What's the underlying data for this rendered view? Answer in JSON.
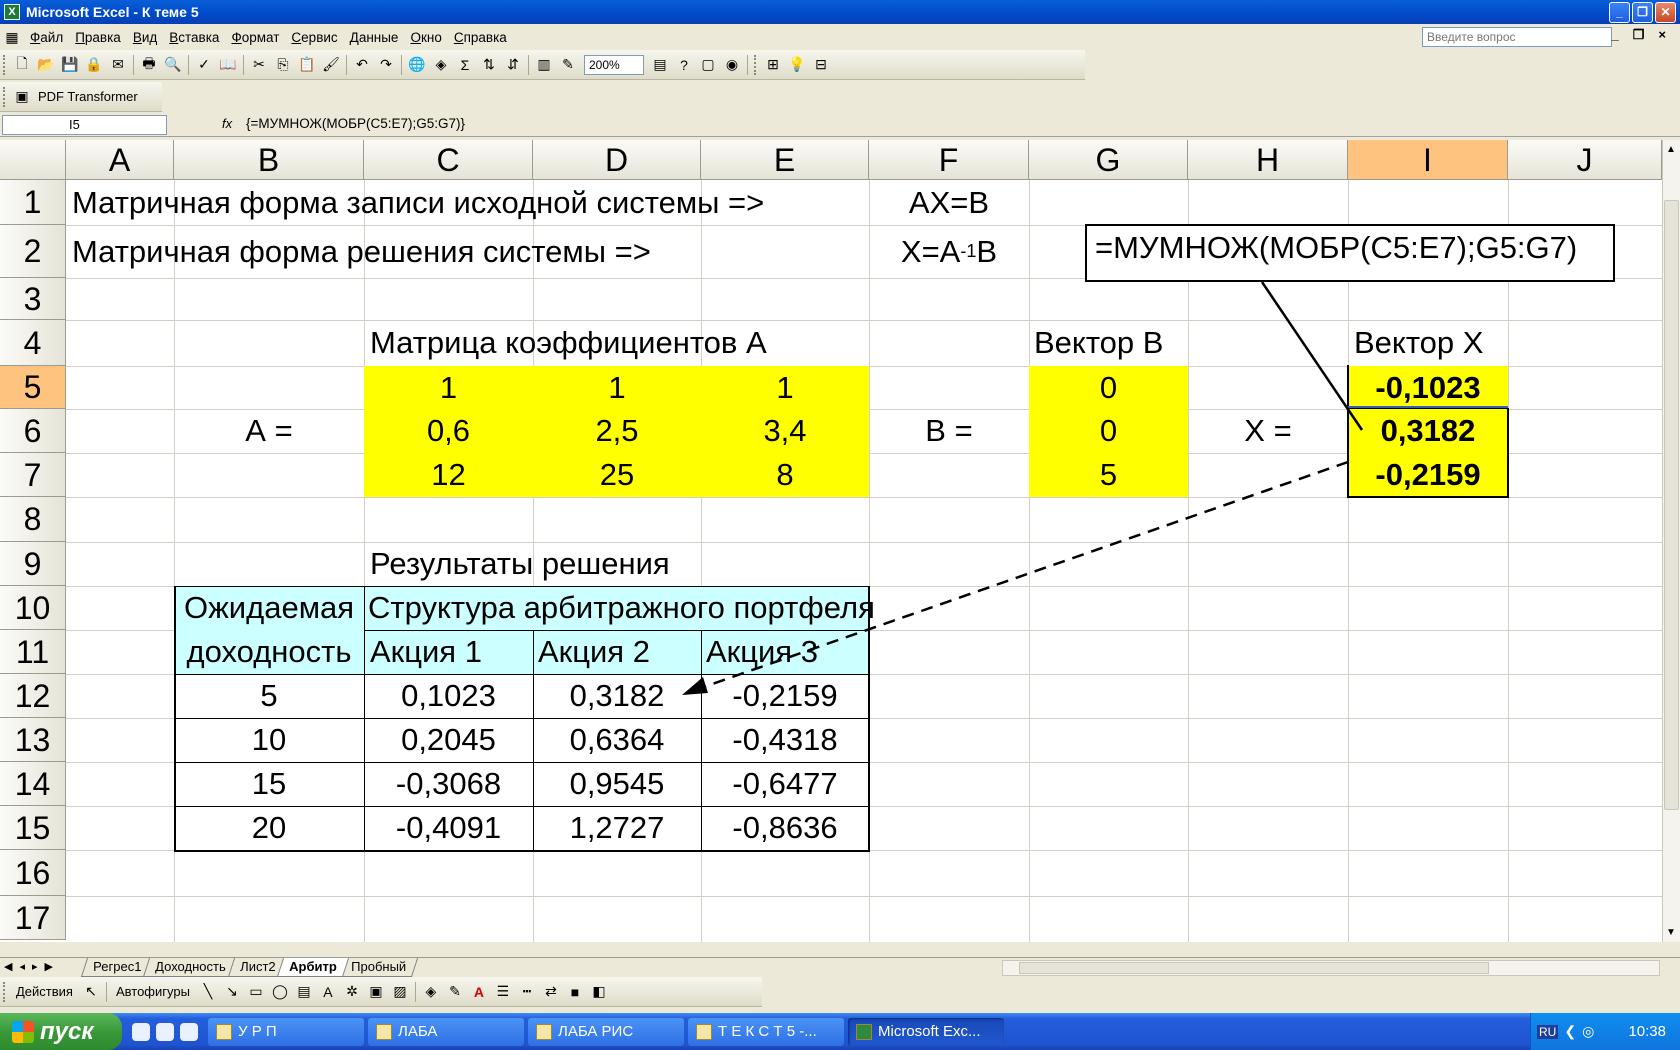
{
  "window": {
    "title": "Microsoft Excel - К теме 5",
    "btn_min": "_",
    "btn_max": "❐",
    "btn_close": "✕"
  },
  "menu": [
    "Файл",
    "Правка",
    "Вид",
    "Вставка",
    "Формат",
    "Сервис",
    "Данные",
    "Окно",
    "Справка"
  ],
  "help_box": {
    "placeholder": "Введите вопрос"
  },
  "mdi": {
    "min": "_",
    "restore": "❐",
    "close": "×"
  },
  "toolbar": {
    "zoom": "200%",
    "pdf_label": "PDF Transformer"
  },
  "formula_bar": {
    "cell_ref": "I5",
    "fx": "fx",
    "formula": "{=МУМНОЖ(МОБР(C5:E7);G5:G7)}"
  },
  "columns": [
    "A",
    "B",
    "C",
    "D",
    "E",
    "F",
    "G",
    "H",
    "I",
    "J"
  ],
  "rows": [
    "1",
    "2",
    "3",
    "4",
    "5",
    "6",
    "7",
    "8",
    "9",
    "10",
    "11",
    "12",
    "13",
    "14",
    "15",
    "16",
    "17"
  ],
  "cells": {
    "r1_label": "Матричная форма записи исходной системы =>",
    "r1_eq": "AX=B",
    "r2_label": "Матричная форма решения системы =>",
    "r2_eq_a": "X=A",
    "r2_eq_sup": "-1",
    "r2_eq_b": "B",
    "matrix_title": "Матрица коэффициентов  А",
    "vector_b_title": "Вектор В",
    "vector_x_title": "Вектор Х",
    "a_label": "А =",
    "b_label": "В =",
    "x_label": "Х =",
    "matrix_a": [
      [
        "1",
        "1",
        "1"
      ],
      [
        "0,6",
        "2,5",
        "3,4"
      ],
      [
        "12",
        "25",
        "8"
      ]
    ],
    "vector_b": [
      "0",
      "0",
      "5"
    ],
    "vector_x": [
      "-0,1023",
      "0,3182",
      "-0,2159"
    ],
    "callout": "=МУМНОЖ(МОБР(C5:E7);G5:G7)",
    "results_title": "Результаты решения",
    "hdr_expected_1": "Ожидаемая",
    "hdr_expected_2": "доходность",
    "hdr_structure": "Структура арбитражного портфеля",
    "hdr_stocks": [
      "Акция 1",
      "Акция 2",
      "Акция 3"
    ],
    "results": [
      [
        "5",
        "0,1023",
        "0,3182",
        "-0,2159"
      ],
      [
        "10",
        "0,2045",
        "0,6364",
        "-0,4318"
      ],
      [
        "15",
        "-0,3068",
        "0,9545",
        "-0,6477"
      ],
      [
        "20",
        "-0,4091",
        "1,2727",
        "-0,8636"
      ]
    ]
  },
  "sheet_tabs": [
    "Регрес1",
    "Доходность",
    "Лист2",
    "Арбитр",
    "Пробный"
  ],
  "active_sheet": "Арбитр",
  "draw_toolbar": {
    "actions": "Действия",
    "autoshapes": "Автофигуры"
  },
  "taskbar": {
    "start": "пуск",
    "tasks": [
      "У Р П",
      "ЛАБА",
      "ЛАБА РИС",
      "Т Е К С Т 5 -...",
      "Microsoft Exc..."
    ],
    "lang": "RU",
    "clock": "10:38"
  },
  "colors": {
    "yellow": "#ffff00",
    "cyan": "#ccffff",
    "selection": "#ffc380"
  }
}
